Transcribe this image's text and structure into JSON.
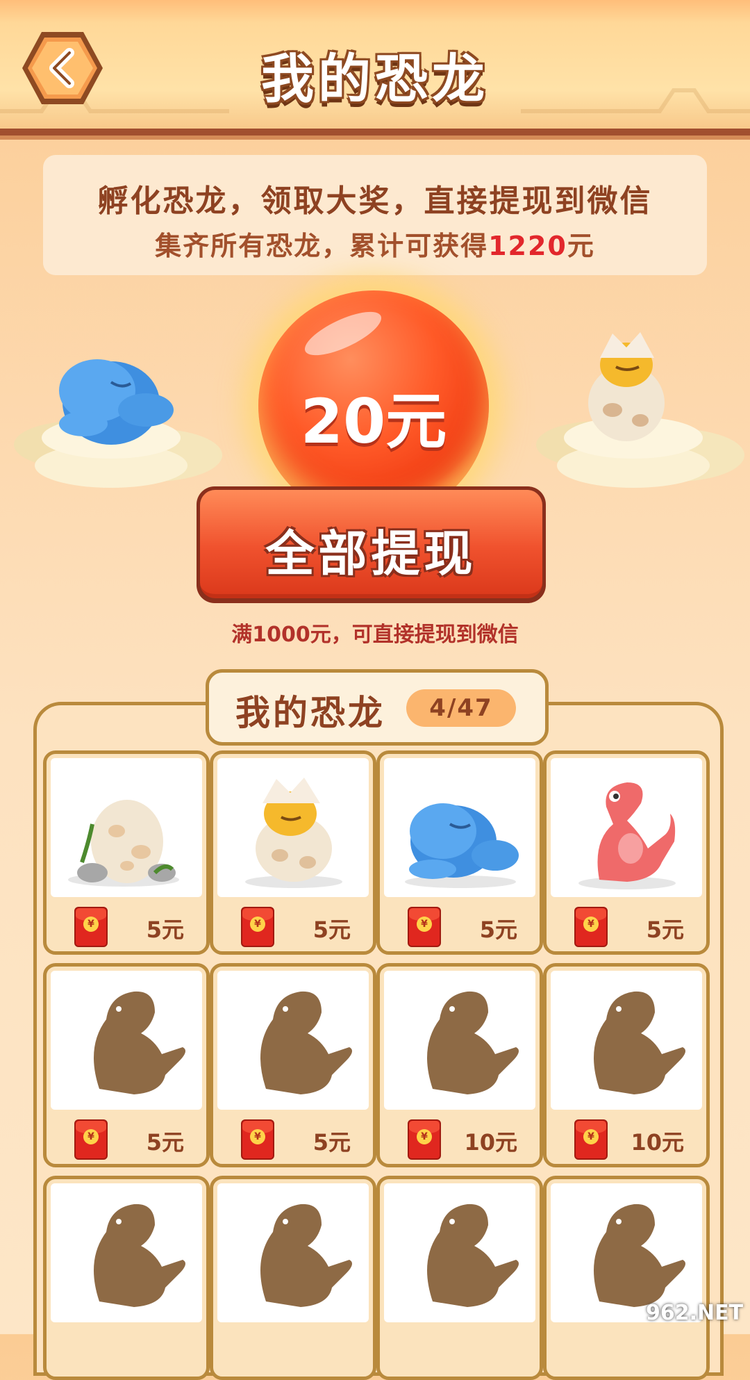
{
  "header": {
    "title": "我的恐龙",
    "back_icon": "chevron-left-icon"
  },
  "banner": {
    "line1": "孵化恐龙，领取大奖，直接提现到微信",
    "line2_prefix": "集齐所有恐龙，累计可获得",
    "line2_amount": "1220",
    "line2_suffix": "元"
  },
  "balance": {
    "value": "20元"
  },
  "withdraw": {
    "label": "全部提现",
    "note": "满1000元，可直接提现到微信"
  },
  "collection": {
    "title": "我的恐龙",
    "count": "4/47",
    "cards": [
      {
        "value": "5元",
        "state": "egg"
      },
      {
        "value": "5元",
        "state": "hatching"
      },
      {
        "value": "5元",
        "state": "blue-dino"
      },
      {
        "value": "5元",
        "state": "red-dino"
      },
      {
        "value": "5元",
        "state": "locked"
      },
      {
        "value": "5元",
        "state": "locked"
      },
      {
        "value": "10元",
        "state": "locked"
      },
      {
        "value": "10元",
        "state": "locked"
      },
      {
        "value": "",
        "state": "locked"
      },
      {
        "value": "",
        "state": "locked"
      },
      {
        "value": "",
        "state": "locked"
      },
      {
        "value": "",
        "state": "locked"
      }
    ]
  },
  "watermark": "962.NET",
  "colors": {
    "accent": "#f0522e",
    "brown": "#8e4222",
    "highlight": "#e2272c"
  }
}
